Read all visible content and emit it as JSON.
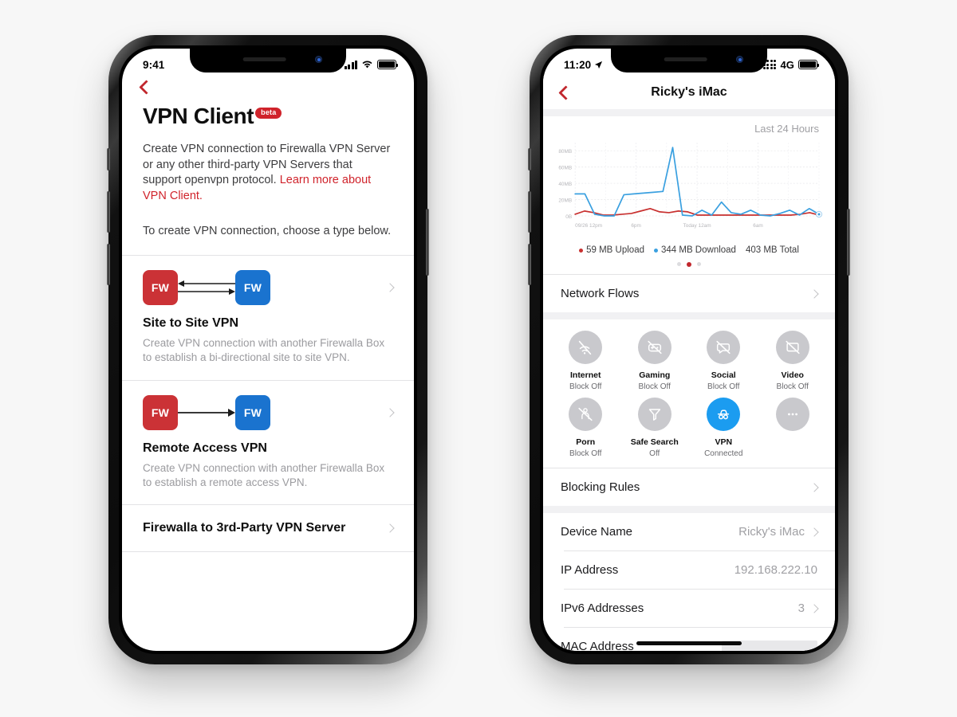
{
  "background_color": "#f7f7f7",
  "accent_red": "#c1272d",
  "accent_blue": "#1b9cf0",
  "left_phone": {
    "status_bar": {
      "time": "9:41",
      "signal_icon": "cellular-bars-icon",
      "wifi_icon": "wifi-icon",
      "battery_icon": "battery-full-icon"
    },
    "back_icon": "back-chevron-icon",
    "title": "VPN Client",
    "badge": "beta",
    "description_part1": "Create VPN connection to Firewalla VPN Server or any other third-party VPN Servers that support openvpn protocol. ",
    "description_link": "Learn more about VPN Client.",
    "subtitle": "To create VPN connection, choose a type below.",
    "options": [
      {
        "diagram": "bidirectional-fw-to-fw",
        "left_box": "FW",
        "right_box": "FW",
        "name": "Site to Site VPN",
        "desc": "Create VPN connection with another Firewalla Box to establish a bi-directional site to site VPN."
      },
      {
        "diagram": "unidirectional-fw-to-fw",
        "left_box": "FW",
        "right_box": "FW",
        "name": "Remote Access VPN",
        "desc": "Create VPN connection with another Firewalla Box to establish a remote access VPN."
      }
    ],
    "third_party_row": "Firewalla to 3rd-Party VPN Server"
  },
  "right_phone": {
    "status_bar": {
      "time": "11:20",
      "location_icon": "location-arrow-icon",
      "signal_icon": "cellular-dots-icon",
      "network": "4G",
      "battery_icon": "battery-full-icon"
    },
    "nav": {
      "back_icon": "back-chevron-icon",
      "title": "Ricky's iMac"
    },
    "chart_range_label": "Last 24 Hours",
    "legend": {
      "upload": "59 MB Upload",
      "download": "344 MB Download",
      "total": "403 MB Total"
    },
    "pager": {
      "count": 3,
      "active_index": 1
    },
    "network_flows_row": "Network Flows",
    "feature_grid": [
      {
        "name": "Internet",
        "state": "Block Off",
        "icon": "wifi-off-icon",
        "active": false
      },
      {
        "name": "Gaming",
        "state": "Block Off",
        "icon": "gamepad-off-icon",
        "active": false
      },
      {
        "name": "Social",
        "state": "Block Off",
        "icon": "chat-off-icon",
        "active": false
      },
      {
        "name": "Video",
        "state": "Block Off",
        "icon": "screen-off-icon",
        "active": false
      },
      {
        "name": "Porn",
        "state": "Block Off",
        "icon": "no-adult-icon",
        "active": false
      },
      {
        "name": "Safe Search",
        "state": "Off",
        "icon": "funnel-icon",
        "active": false
      },
      {
        "name": "VPN",
        "state": "Connected",
        "icon": "incognito-icon",
        "active": true
      },
      {
        "name": "",
        "state": "",
        "icon": "ellipsis-icon",
        "active": false
      }
    ],
    "blocking_rules_row": "Blocking Rules",
    "details": [
      {
        "label": "Device Name",
        "value": "Ricky's iMac",
        "chevron": true
      },
      {
        "label": "IP Address",
        "value": "192.168.222.10",
        "chevron": false
      },
      {
        "label": "IPv6 Addresses",
        "value": "3",
        "chevron": true
      },
      {
        "label": "MAC Address",
        "value": "",
        "chevron": false,
        "redacted": true
      }
    ]
  },
  "chart_data": {
    "type": "line",
    "title": "Last 24 Hours",
    "xlabel": "",
    "ylabel": "",
    "ylim": [
      0,
      90
    ],
    "ytick_labels": [
      "0B",
      "20MB",
      "40MB",
      "60MB",
      "80MB"
    ],
    "ytick_values": [
      0,
      20,
      40,
      60,
      80
    ],
    "xtick_labels": [
      "09/26 12pm",
      "6pm",
      "Today 12am",
      "6am"
    ],
    "xtick_positions": [
      0,
      6,
      12,
      18
    ],
    "grid": true,
    "legend_position": "bottom",
    "x": [
      0,
      1,
      2,
      3,
      4,
      5,
      6,
      7,
      8,
      9,
      10,
      11,
      12,
      13,
      14,
      15,
      16,
      17,
      18,
      19,
      20,
      21,
      22,
      23,
      24
    ],
    "series": [
      {
        "name": "344 MB Download",
        "color": "#3aa0e0",
        "values": [
          27,
          27,
          2,
          0,
          0,
          26,
          27,
          28,
          29,
          30,
          84,
          1,
          0,
          7,
          1,
          17,
          4,
          2,
          7,
          1,
          0,
          3,
          7,
          1,
          9,
          2
        ]
      },
      {
        "name": "59 MB Upload",
        "color": "#c8302f",
        "values": [
          2,
          6,
          4,
          1,
          1,
          2,
          3,
          6,
          9,
          5,
          4,
          6,
          5,
          1,
          1,
          1,
          1,
          1,
          1,
          1,
          1,
          1,
          1,
          1,
          2,
          4,
          1
        ]
      }
    ]
  }
}
